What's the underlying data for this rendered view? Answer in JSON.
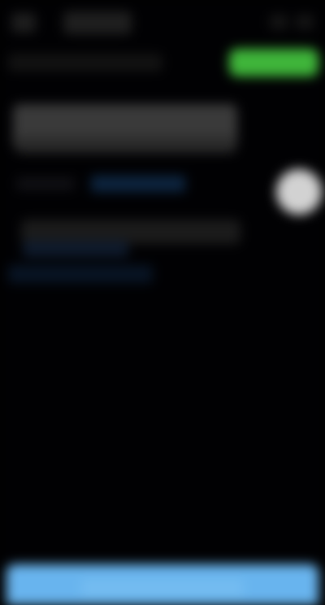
{
  "colors": {
    "background": "#010103",
    "accent_green": "#3fb53a",
    "accent_blue": "#68b4ee",
    "circle_button": "#d2d2d2",
    "link_blue": "#0d2540"
  },
  "icons": {
    "back": "back-icon",
    "top_right": [
      "overflow-icon",
      "share-icon"
    ]
  }
}
